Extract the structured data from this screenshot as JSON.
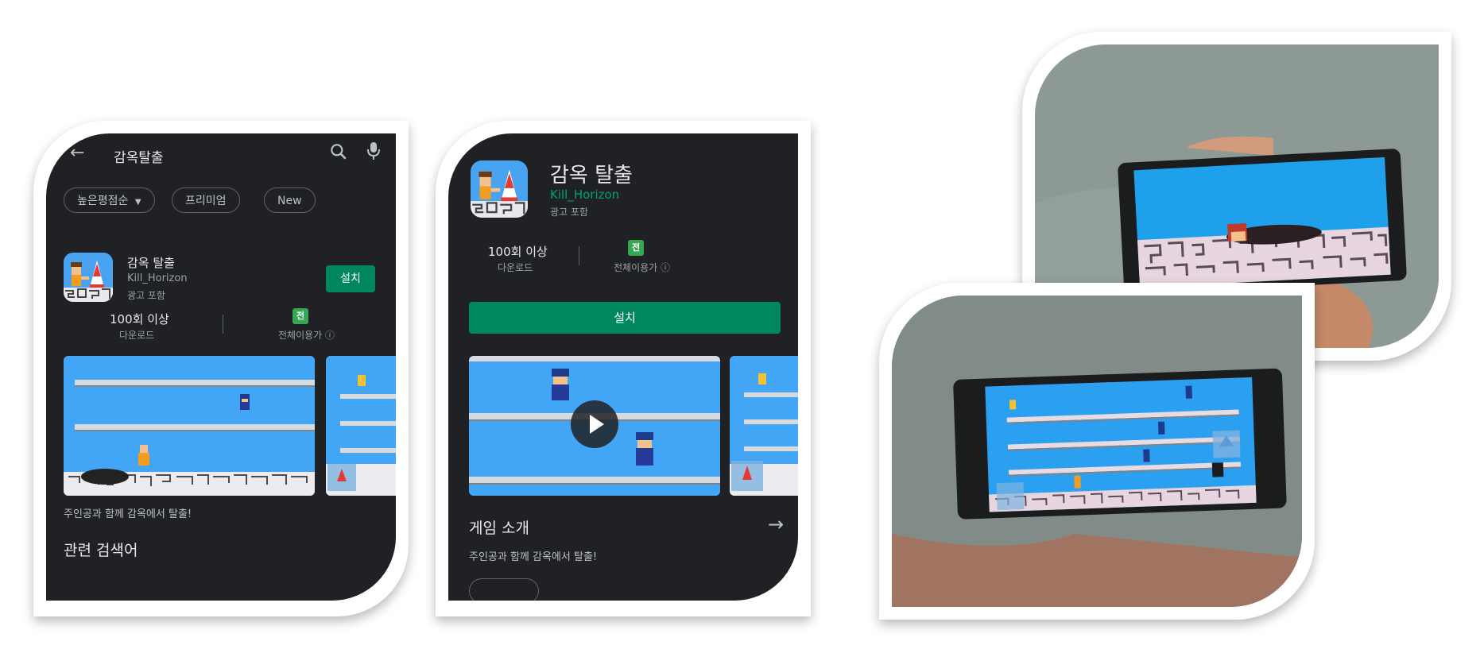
{
  "search_screen": {
    "query": "감옥탈출",
    "chips": [
      "높은평점순",
      "프리미엄",
      "New"
    ],
    "app": {
      "title": "감옥 탈출",
      "developer": "Kill_Horizon",
      "ads": "광고 포함",
      "install_label": "설치"
    },
    "stats": {
      "downloads_value": "100회 이상",
      "downloads_label": "다운로드",
      "rating_badge": "전",
      "rating_label": "전체이용가"
    },
    "description": "주인공과 함께 감옥에서 탈출!",
    "related_heading": "관련 검색어"
  },
  "detail_screen": {
    "title": "감옥 탈출",
    "developer": "Kill_Horizon",
    "ads": "광고 포함",
    "stats": {
      "downloads_value": "100회 이상",
      "downloads_label": "다운로드",
      "rating_badge": "전",
      "rating_label": "전체이용가"
    },
    "install_label": "설치",
    "about_heading": "게임 소개",
    "description": "주인공과 함께 감옥에서 탈출!"
  },
  "colors": {
    "background": "#202124",
    "install_green": "#01875f",
    "developer_green": "#00a173",
    "game_sky": "#42a5f5"
  },
  "icons": [
    "back-arrow-icon",
    "search-icon",
    "mic-icon",
    "chevron-down-icon",
    "info-icon",
    "play-icon",
    "arrow-right-icon",
    "rating-badge-icon"
  ]
}
